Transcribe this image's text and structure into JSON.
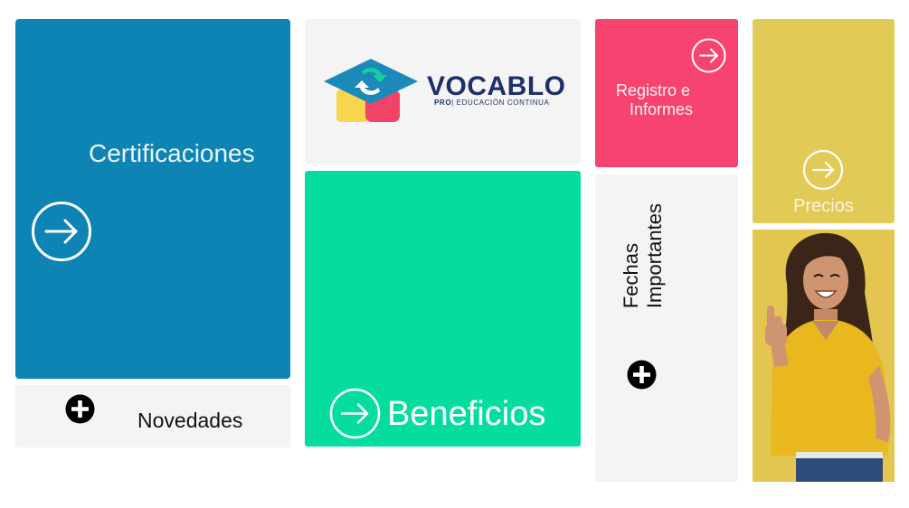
{
  "certificaciones": {
    "label": "Certificaciones"
  },
  "novedades": {
    "label": "Novedades"
  },
  "logo": {
    "name": "VOCABLO",
    "tagline_pro": "PRO",
    "tagline_rest": "| EDUCACIÓN CONTINUA"
  },
  "beneficios": {
    "label": "Beneficios"
  },
  "registro": {
    "line1": "Registro e",
    "line2": "Informes"
  },
  "fechas": {
    "line1": "Fechas",
    "line2": "Importantes"
  },
  "precios": {
    "label": "Precios"
  },
  "colors": {
    "certificaciones": "#0e84b4",
    "beneficios": "#05dd9f",
    "registro": "#f74370",
    "precios": "#e2ca57",
    "neutral": "#f4f4f4"
  }
}
